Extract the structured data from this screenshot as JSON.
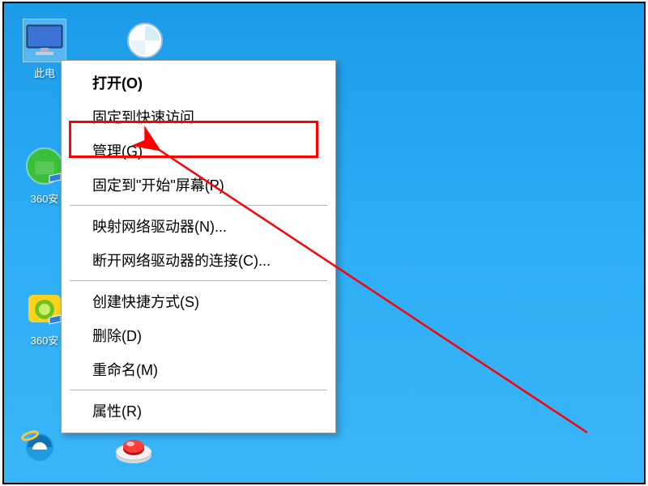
{
  "desktop_icons": {
    "this_pc": {
      "label": "此电"
    },
    "sec_360": {
      "label": "360安"
    },
    "soft_360": {
      "label": "360安"
    }
  },
  "context_menu": {
    "open": "打开(O)",
    "pin_quick": "固定到快速访问",
    "manage": "管理(G)",
    "pin_start": "固定到\"开始\"屏幕(P)",
    "map_drive": "映射网络驱动器(N)...",
    "disconnect_drive": "断开网络驱动器的连接(C)...",
    "create_shortcut": "创建快捷方式(S)",
    "delete": "删除(D)",
    "rename": "重命名(M)",
    "properties": "属性(R)"
  }
}
